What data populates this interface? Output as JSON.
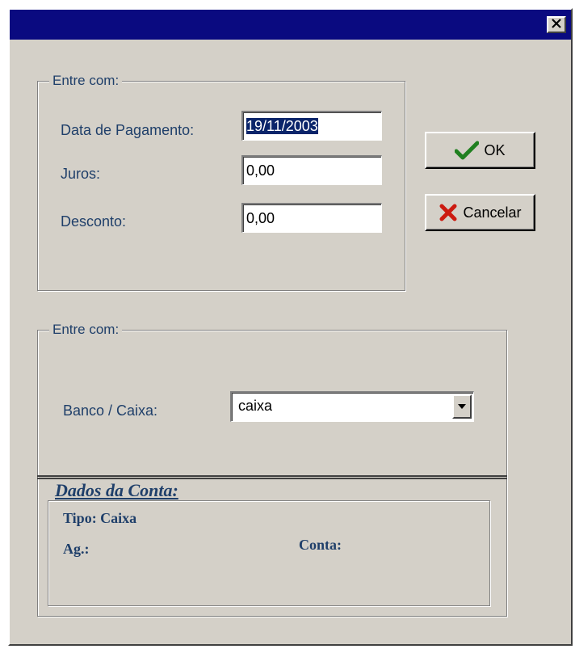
{
  "window": {
    "close_label": "×"
  },
  "group1": {
    "legend": "Entre com:",
    "fields": [
      {
        "label": "Data de Pagamento:",
        "value": "19/11/2003"
      },
      {
        "label": "Juros:",
        "value": "0,00"
      },
      {
        "label": "Desconto:",
        "value": "0,00"
      }
    ]
  },
  "buttons": {
    "ok": "OK",
    "cancel": "Cancelar"
  },
  "group2": {
    "legend": "Entre com:",
    "banco_label": "Banco / Caixa:",
    "banco_value": "caixa"
  },
  "account": {
    "heading": "Dados da Conta:",
    "tipo": "Tipo: Caixa",
    "ag": "Ag.:",
    "conta": "Conta:"
  },
  "colors": {
    "titlebar": "#0a0a80",
    "face": "#d4d0c8",
    "label": "#1f3f6a",
    "selection": "#0a246a"
  }
}
